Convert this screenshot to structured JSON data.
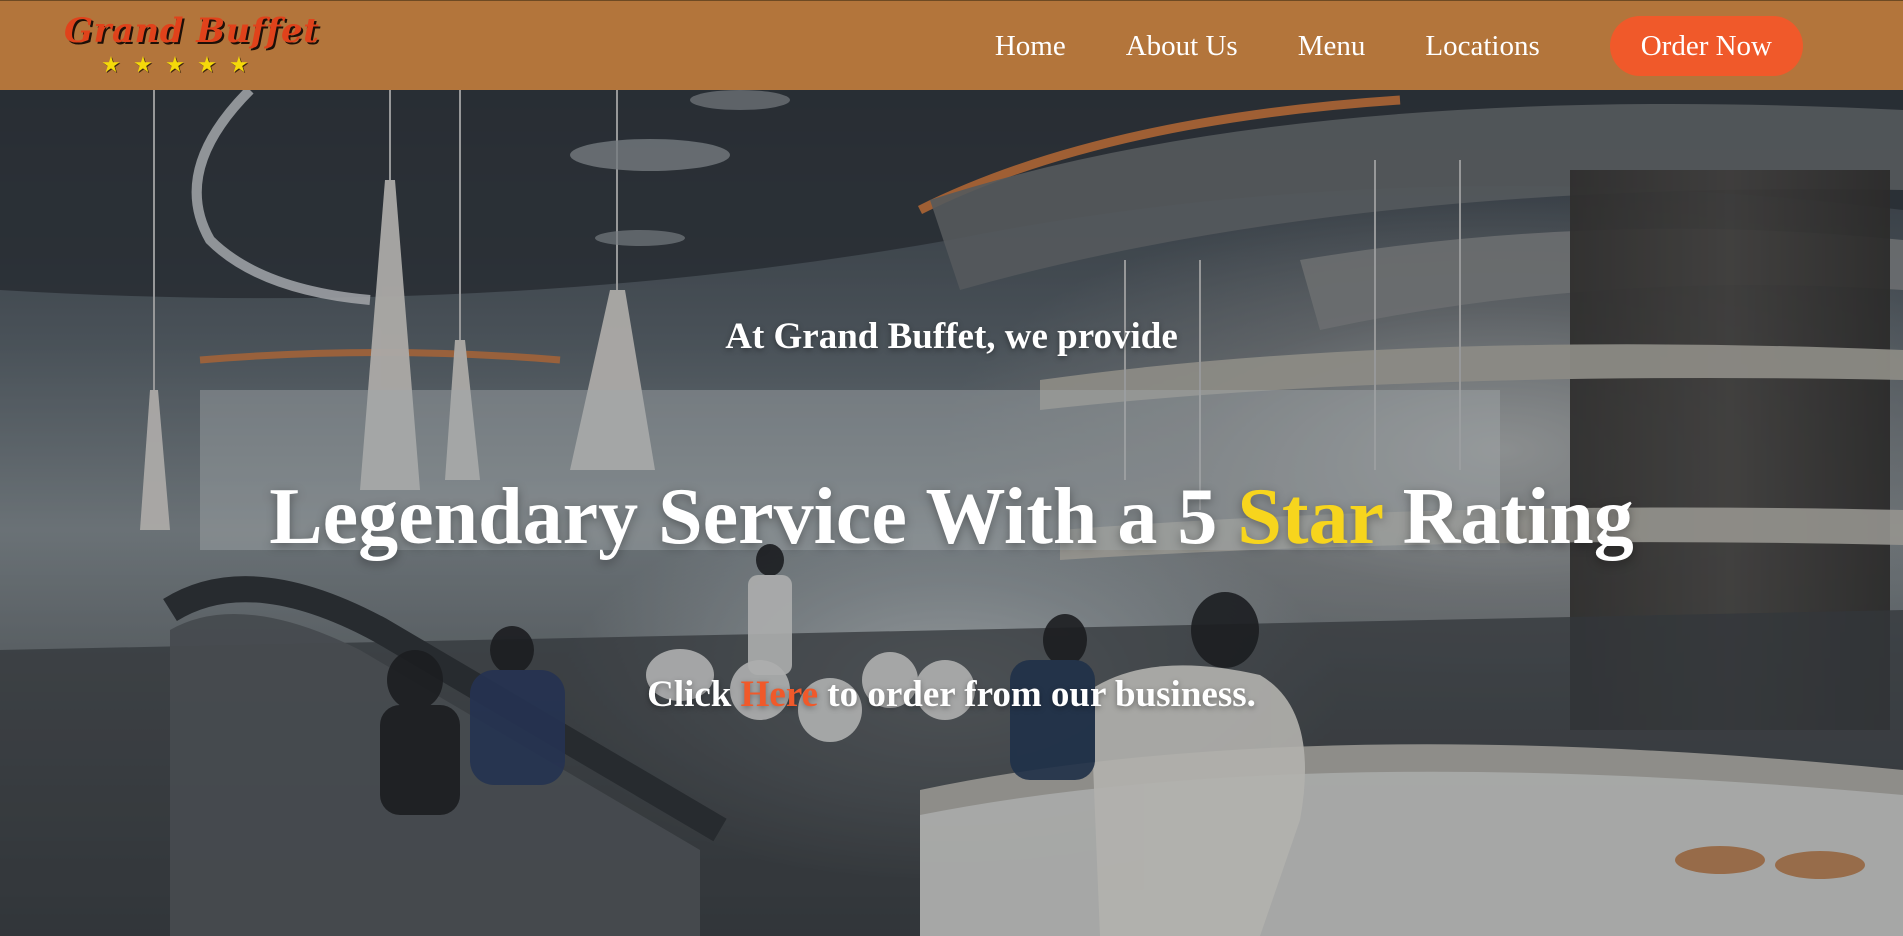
{
  "brand": {
    "name": "Grand Buffet",
    "star_count": 5
  },
  "nav": {
    "items": [
      {
        "label": "Home"
      },
      {
        "label": "About Us"
      },
      {
        "label": "Menu"
      },
      {
        "label": "Locations"
      }
    ],
    "cta_label": "Order Now"
  },
  "hero": {
    "tagline": "At Grand Buffet, we provide",
    "headline_before": "Legendary Service With a 5 ",
    "headline_accent": "Star",
    "headline_after": " Rating",
    "cta_before": "Click ",
    "cta_link": "Here",
    "cta_after": " to order from our business."
  },
  "colors": {
    "header_bg": "#b3753b",
    "accent_orange": "#f0592a",
    "accent_yellow": "#f7d51d",
    "logo_red": "#e0421b"
  },
  "icons": {
    "star": "star-icon"
  }
}
